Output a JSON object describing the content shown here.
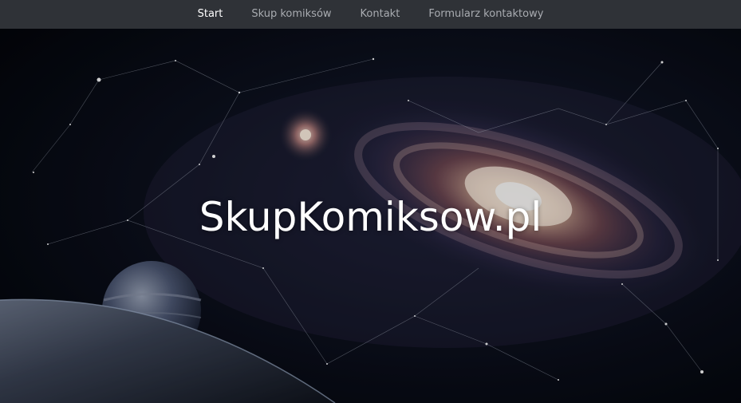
{
  "nav": {
    "items": [
      {
        "label": "Start",
        "active": true
      },
      {
        "label": "Skup komiksów",
        "active": false
      },
      {
        "label": "Kontakt",
        "active": false
      },
      {
        "label": "Formularz kontaktowy",
        "active": false
      }
    ]
  },
  "hero": {
    "title": "SkupKomiksow.pl"
  },
  "colors": {
    "navbar_bg": "#2f3237",
    "nav_text": "#a9acb1",
    "nav_active": "#ffffff",
    "space_bg": "#05070c"
  }
}
